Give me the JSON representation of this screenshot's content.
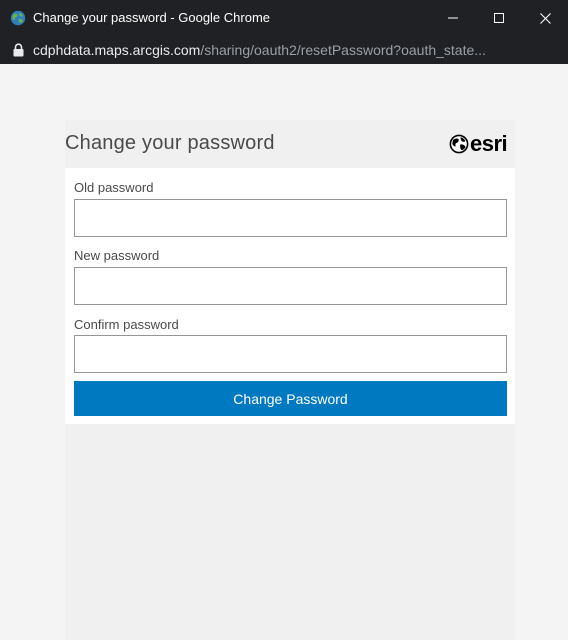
{
  "window": {
    "title": "Change your password - Google Chrome",
    "url_host": "cdphdata.maps.arcgis.com",
    "url_path": "/sharing/oauth2/resetPassword?oauth_state..."
  },
  "form": {
    "heading": "Change your password",
    "logo_text": "esri",
    "old_password_label": "Old password",
    "old_password_value": "",
    "new_password_label": "New password",
    "new_password_value": "",
    "confirm_password_label": "Confirm password",
    "confirm_password_value": "",
    "submit_label": "Change Password"
  },
  "icons": {
    "title_favicon": "globe-icon",
    "lock": "lock-icon",
    "minimize": "minimize-icon",
    "maximize": "maximize-icon",
    "close": "close-icon",
    "logo_globe": "esri-globe-icon"
  },
  "colors": {
    "titlebar": "#202124",
    "url_host": "#e8eaed",
    "url_path": "#9aa0a6",
    "button": "#0079c1",
    "page_background": "#f4f4f4"
  }
}
